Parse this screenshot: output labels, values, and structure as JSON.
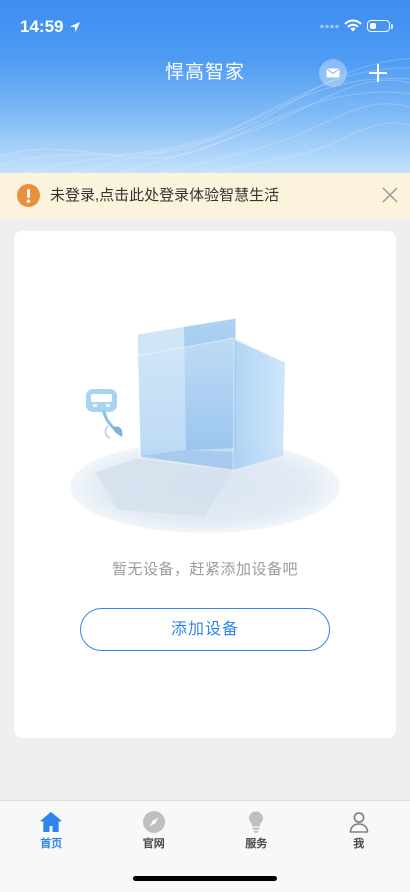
{
  "status_bar": {
    "time": "14:59",
    "battery_level": 0.35,
    "icons": [
      "location-arrow-icon",
      "signal-icon",
      "wifi-icon",
      "battery-icon"
    ]
  },
  "header": {
    "title": "悍高智家",
    "actions": [
      "mail-icon",
      "plus-icon"
    ]
  },
  "notice": {
    "icon": "warning-icon",
    "text": "未登录,点击此处登录体验智慧生活",
    "close_icon": "close-icon"
  },
  "empty_state": {
    "message": "暂无设备，赶紧添加设备吧",
    "button_label": "添加设备"
  },
  "tabs": [
    {
      "label": "首页",
      "icon": "home-icon",
      "active": true
    },
    {
      "label": "官网",
      "icon": "compass-icon",
      "active": false
    },
    {
      "label": "服务",
      "icon": "lightbulb-icon",
      "active": false
    },
    {
      "label": "我",
      "icon": "user-icon",
      "active": false
    }
  ],
  "colors": {
    "accent": "#2f86ea",
    "notice_background": "#fcf3dc",
    "warning": "#e8913a"
  }
}
